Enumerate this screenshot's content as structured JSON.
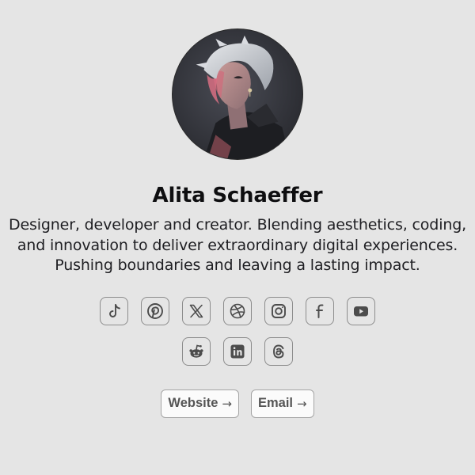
{
  "profile": {
    "name": "Alita Schaeffer",
    "bio": "Designer, developer and creator. Blending aesthetics, coding, and innovation to deliver extraordinary digital experiences. Pushing boundaries and leaving a lasting impact.",
    "avatar_icon": "avatar-portrait"
  },
  "socials": [
    {
      "icon": "tiktok-icon"
    },
    {
      "icon": "pinterest-icon"
    },
    {
      "icon": "x-icon"
    },
    {
      "icon": "dribbble-icon"
    },
    {
      "icon": "instagram-icon"
    },
    {
      "icon": "facebook-icon"
    },
    {
      "icon": "youtube-icon"
    },
    {
      "icon": "reddit-icon"
    },
    {
      "icon": "linkedin-icon"
    },
    {
      "icon": "threads-icon"
    }
  ],
  "links": {
    "website_label": "Website",
    "email_label": "Email",
    "arrow": "→"
  },
  "colors": {
    "background": "#e5e5e5",
    "text": "#111111",
    "icon": "#4c4c4c",
    "border": "#8c8c8c"
  }
}
